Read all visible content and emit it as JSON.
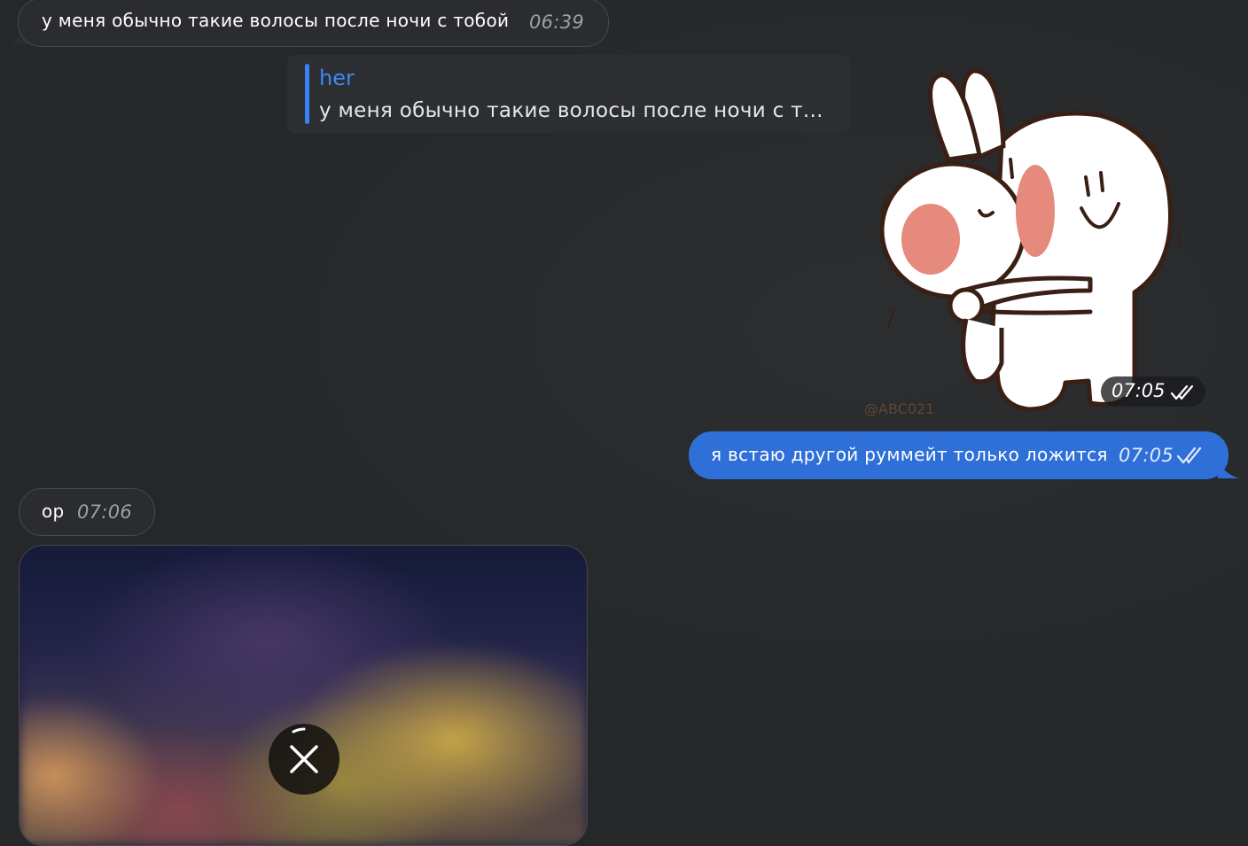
{
  "messages": [
    {
      "text": "у меня обычно такие волосы после ночи с тобой",
      "time": "06:39"
    },
    {
      "text": "я встаю другой руммейт только ложится",
      "time": "07:05"
    },
    {
      "text": "ор",
      "time": "07:06"
    }
  ],
  "reply": {
    "name": "her",
    "text": "у меня обычно такие волосы после ночи с т..."
  },
  "sticker": {
    "time": "07:05",
    "watermark": "@ABC021"
  },
  "colors": {
    "accent": "#2f6fd8",
    "reply_name": "#3a8af5",
    "background": "#252729"
  }
}
